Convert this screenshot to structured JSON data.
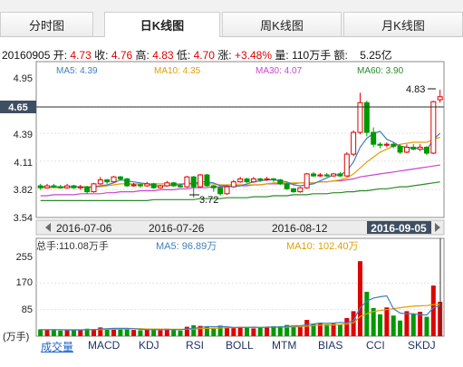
{
  "tabs": [
    {
      "label": "分时图",
      "active": false
    },
    {
      "label": "日K线图",
      "active": true
    },
    {
      "label": "周K线图",
      "active": false
    },
    {
      "label": "月K线图",
      "active": false
    }
  ],
  "info": {
    "date": "20160905",
    "open_label": "开:",
    "open": "4.73",
    "close_label": "收:",
    "close": "4.76",
    "high_label": "高:",
    "high": "4.83",
    "low_label": "低:",
    "low": "4.70",
    "change_label": "涨:",
    "change": "+3.48%",
    "volume_label": "量:",
    "volume": "110万手",
    "amount_label": "额:",
    "amount": "5.25亿"
  },
  "ma": {
    "ma5": "MA5: 4.39",
    "ma10": "MA10: 4.35",
    "ma30": "MA30: 4.07",
    "ma60": "MA60: 3.90"
  },
  "colors": {
    "up": "#e00000",
    "down": "#009900",
    "ma5": "#3f7fbf",
    "ma10": "#e0a000",
    "ma30": "#cc44cc",
    "ma60": "#2a8a2a"
  },
  "price_axis": [
    "4.95",
    "4.65",
    "4.39",
    "4.11",
    "3.82",
    "3.54"
  ],
  "current_price": "4.65",
  "max_label": "4.83",
  "min_label": "3.72",
  "date_axis": [
    "2016-07-06",
    "2016-07-26",
    "2016-08-12",
    "2016-09-05"
  ],
  "volume_header": {
    "total": "总手:110.08万手",
    "ma5": "MA5: 96.89万",
    "ma10": "MA10: 102.40万"
  },
  "volume_axis": [
    "255",
    "170",
    "85"
  ],
  "volume_unit": "(万手)",
  "indicators": [
    "成交量",
    "MACD",
    "KDJ",
    "RSI",
    "BOLL",
    "MTM",
    "BIAS",
    "CCI",
    "SKDJ"
  ],
  "chart_data": {
    "type": "candlestick",
    "ylim": [
      3.54,
      4.95
    ],
    "ohlc": [
      [
        3.86,
        3.84,
        3.88,
        3.82
      ],
      [
        3.84,
        3.86,
        3.88,
        3.83
      ],
      [
        3.86,
        3.85,
        3.88,
        3.84
      ],
      [
        3.85,
        3.84,
        3.87,
        3.83
      ],
      [
        3.84,
        3.86,
        3.88,
        3.83
      ],
      [
        3.86,
        3.84,
        3.87,
        3.83
      ],
      [
        3.84,
        3.85,
        3.87,
        3.82
      ],
      [
        3.85,
        3.8,
        3.86,
        3.78
      ],
      [
        3.8,
        3.88,
        3.89,
        3.79
      ],
      [
        3.88,
        3.92,
        3.95,
        3.87
      ],
      [
        3.92,
        3.9,
        3.93,
        3.88
      ],
      [
        3.9,
        3.95,
        3.96,
        3.89
      ],
      [
        3.95,
        3.93,
        3.96,
        3.91
      ],
      [
        3.93,
        3.86,
        3.94,
        3.85
      ],
      [
        3.86,
        3.87,
        3.89,
        3.85
      ],
      [
        3.87,
        3.86,
        3.88,
        3.84
      ],
      [
        3.86,
        3.88,
        3.9,
        3.85
      ],
      [
        3.88,
        3.84,
        3.89,
        3.83
      ],
      [
        3.84,
        3.86,
        3.87,
        3.83
      ],
      [
        3.86,
        3.89,
        3.91,
        3.85
      ],
      [
        3.89,
        3.86,
        3.9,
        3.85
      ],
      [
        3.86,
        3.85,
        3.88,
        3.84
      ],
      [
        3.85,
        3.95,
        3.96,
        3.84
      ],
      [
        3.95,
        3.85,
        3.96,
        3.74
      ],
      [
        3.85,
        3.97,
        3.98,
        3.84
      ],
      [
        3.97,
        3.86,
        3.98,
        3.85
      ],
      [
        3.86,
        3.84,
        3.87,
        3.8
      ],
      [
        3.84,
        3.78,
        3.85,
        3.76
      ],
      [
        3.78,
        3.85,
        3.86,
        3.77
      ],
      [
        3.85,
        3.9,
        3.92,
        3.84
      ],
      [
        3.9,
        3.93,
        3.95,
        3.89
      ],
      [
        3.93,
        3.9,
        3.94,
        3.89
      ],
      [
        3.9,
        3.93,
        3.95,
        3.89
      ],
      [
        3.93,
        3.92,
        3.94,
        3.9
      ],
      [
        3.92,
        3.93,
        3.95,
        3.91
      ],
      [
        3.93,
        3.92,
        3.94,
        3.9
      ],
      [
        3.92,
        3.88,
        3.93,
        3.87
      ],
      [
        3.88,
        3.83,
        3.89,
        3.82
      ],
      [
        3.83,
        3.8,
        3.84,
        3.79
      ],
      [
        3.8,
        3.84,
        3.85,
        3.79
      ],
      [
        3.84,
        3.98,
        3.99,
        3.83
      ],
      [
        3.98,
        3.96,
        4.0,
        3.95
      ],
      [
        3.96,
        3.97,
        3.99,
        3.95
      ],
      [
        3.97,
        3.96,
        3.99,
        3.95
      ],
      [
        3.96,
        3.98,
        3.99,
        3.95
      ],
      [
        3.98,
        3.96,
        4.0,
        3.95
      ],
      [
        3.96,
        4.18,
        4.2,
        3.95
      ],
      [
        4.18,
        4.4,
        4.42,
        4.16
      ],
      [
        4.4,
        4.7,
        4.8,
        4.38
      ],
      [
        4.7,
        4.4,
        4.72,
        4.36
      ],
      [
        4.4,
        4.28,
        4.45,
        4.25
      ],
      [
        4.28,
        4.27,
        4.3,
        4.24
      ],
      [
        4.27,
        4.28,
        4.3,
        4.25
      ],
      [
        4.28,
        4.26,
        4.3,
        4.24
      ],
      [
        4.26,
        4.2,
        4.28,
        4.18
      ],
      [
        4.2,
        4.25,
        4.28,
        4.19
      ],
      [
        4.25,
        4.23,
        4.28,
        4.22
      ],
      [
        4.23,
        4.25,
        4.28,
        4.21
      ],
      [
        4.25,
        4.19,
        4.26,
        4.17
      ],
      [
        4.19,
        4.71,
        4.72,
        4.18
      ],
      [
        4.73,
        4.76,
        4.83,
        4.7
      ]
    ],
    "ma5": [
      3.85,
      3.85,
      3.85,
      3.85,
      3.85,
      3.85,
      3.85,
      3.84,
      3.85,
      3.86,
      3.87,
      3.89,
      3.92,
      3.91,
      3.9,
      3.89,
      3.88,
      3.86,
      3.86,
      3.86,
      3.87,
      3.87,
      3.89,
      3.88,
      3.9,
      3.9,
      3.89,
      3.86,
      3.86,
      3.85,
      3.86,
      3.88,
      3.9,
      3.91,
      3.92,
      3.92,
      3.91,
      3.9,
      3.87,
      3.86,
      3.87,
      3.88,
      3.91,
      3.94,
      3.97,
      3.97,
      4.01,
      4.1,
      4.25,
      4.34,
      4.39,
      4.41,
      4.33,
      4.3,
      4.26,
      4.25,
      4.24,
      4.24,
      4.22,
      4.33,
      4.39
    ],
    "ma10": [
      3.84,
      3.84,
      3.84,
      3.84,
      3.84,
      3.85,
      3.85,
      3.85,
      3.85,
      3.85,
      3.86,
      3.87,
      3.88,
      3.88,
      3.88,
      3.88,
      3.88,
      3.88,
      3.88,
      3.88,
      3.88,
      3.88,
      3.88,
      3.88,
      3.88,
      3.88,
      3.88,
      3.87,
      3.87,
      3.87,
      3.87,
      3.87,
      3.87,
      3.87,
      3.88,
      3.89,
      3.89,
      3.89,
      3.89,
      3.89,
      3.89,
      3.89,
      3.9,
      3.9,
      3.91,
      3.92,
      3.94,
      3.98,
      4.04,
      4.1,
      4.15,
      4.2,
      4.23,
      4.26,
      4.28,
      4.29,
      4.3,
      4.3,
      4.3,
      4.33,
      4.35
    ],
    "ma30": [
      3.76,
      3.76,
      3.77,
      3.77,
      3.77,
      3.77,
      3.78,
      3.78,
      3.78,
      3.78,
      3.79,
      3.79,
      3.8,
      3.8,
      3.8,
      3.81,
      3.81,
      3.81,
      3.82,
      3.82,
      3.82,
      3.83,
      3.83,
      3.84,
      3.84,
      3.84,
      3.85,
      3.85,
      3.85,
      3.86,
      3.86,
      3.86,
      3.87,
      3.87,
      3.88,
      3.88,
      3.88,
      3.88,
      3.88,
      3.89,
      3.89,
      3.89,
      3.9,
      3.9,
      3.91,
      3.91,
      3.92,
      3.93,
      3.95,
      3.96,
      3.97,
      3.98,
      3.99,
      4.0,
      4.01,
      4.02,
      4.03,
      4.04,
      4.05,
      4.06,
      4.07
    ],
    "ma60": [
      3.71,
      3.71,
      3.71,
      3.71,
      3.71,
      3.71,
      3.71,
      3.71,
      3.71,
      3.71,
      3.71,
      3.71,
      3.71,
      3.71,
      3.71,
      3.71,
      3.71,
      3.72,
      3.72,
      3.72,
      3.72,
      3.72,
      3.72,
      3.72,
      3.73,
      3.73,
      3.73,
      3.73,
      3.74,
      3.74,
      3.74,
      3.74,
      3.75,
      3.75,
      3.75,
      3.76,
      3.76,
      3.76,
      3.77,
      3.77,
      3.77,
      3.78,
      3.78,
      3.78,
      3.79,
      3.79,
      3.8,
      3.8,
      3.81,
      3.81,
      3.82,
      3.83,
      3.83,
      3.84,
      3.85,
      3.85,
      3.86,
      3.87,
      3.88,
      3.89,
      3.9
    ],
    "volume_ylim": [
      0,
      255
    ],
    "volume": [
      22,
      20,
      21,
      18,
      20,
      19,
      20,
      24,
      23,
      28,
      24,
      25,
      22,
      24,
      20,
      19,
      21,
      22,
      19,
      24,
      20,
      18,
      30,
      35,
      33,
      30,
      24,
      34,
      28,
      26,
      30,
      30,
      25,
      28,
      30,
      32,
      32,
      36,
      34,
      31,
      52,
      40,
      42,
      38,
      40,
      36,
      58,
      80,
      240,
      142,
      90,
      70,
      92,
      66,
      50,
      80,
      72,
      78,
      62,
      162,
      110
    ],
    "vol_ma5": [
      21,
      21,
      21,
      21,
      20,
      20,
      20,
      21,
      21,
      23,
      24,
      25,
      25,
      25,
      24,
      22,
      21,
      21,
      21,
      21,
      21,
      21,
      23,
      25,
      28,
      31,
      30,
      31,
      30,
      28,
      28,
      28,
      29,
      28,
      29,
      29,
      29,
      31,
      33,
      33,
      37,
      39,
      42,
      41,
      42,
      44,
      43,
      50,
      91,
      112,
      122,
      126,
      129,
      88,
      74,
      72,
      72,
      68,
      68,
      91,
      97
    ],
    "vol_ma10": [
      21,
      21,
      21,
      21,
      21,
      21,
      21,
      21,
      21,
      21,
      22,
      22,
      23,
      23,
      24,
      24,
      23,
      23,
      23,
      22,
      22,
      22,
      22,
      23,
      24,
      25,
      25,
      26,
      27,
      27,
      28,
      28,
      28,
      28,
      29,
      29,
      29,
      29,
      30,
      30,
      32,
      34,
      35,
      35,
      36,
      37,
      39,
      43,
      63,
      72,
      79,
      82,
      85,
      88,
      91,
      94,
      96,
      97,
      98,
      101,
      102
    ]
  }
}
